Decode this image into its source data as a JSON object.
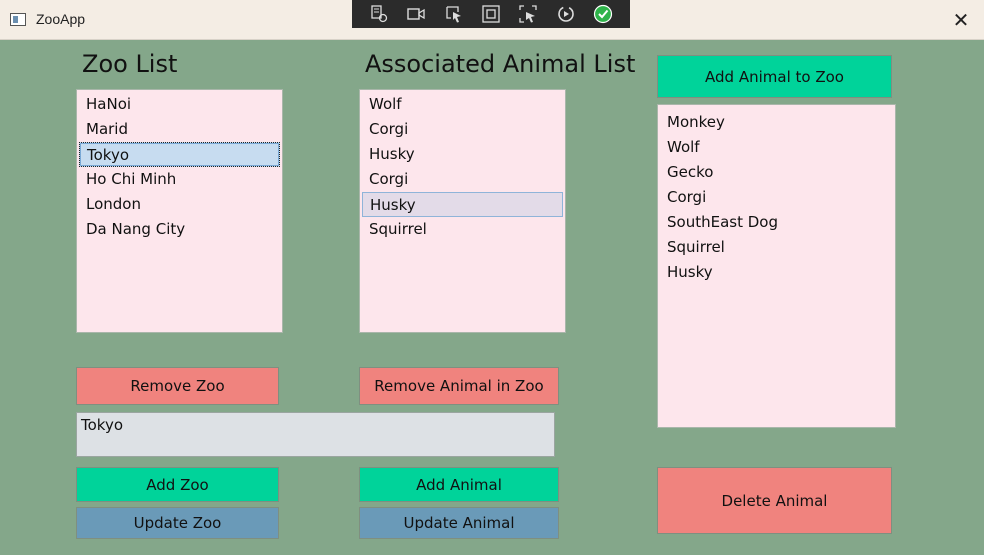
{
  "window": {
    "title": "ZooApp",
    "close_glyph": "✕"
  },
  "debug_toolbar": {
    "icons": [
      "live-visual-tree-icon",
      "record-icon",
      "select-element-icon",
      "display-layout-adorners-icon",
      "track-focus-icon",
      "hot-reload-icon",
      "binding-check-icon"
    ]
  },
  "zoo_list": {
    "heading": "Zoo List",
    "items": [
      "HaNoi",
      "Marid",
      "Tokyo",
      "Ho Chi Minh",
      "London",
      "Da Nang City"
    ],
    "selected": "Tokyo"
  },
  "associated_animals": {
    "heading": "Associated Animal List",
    "items": [
      "Wolf",
      "Corgi",
      "Husky",
      "Corgi",
      "Husky",
      "Squirrel"
    ],
    "selected_index": 4
  },
  "all_animals": {
    "items": [
      "Monkey",
      "Wolf",
      "Gecko",
      "Corgi",
      "SouthEast Dog",
      "Squirrel",
      "Husky"
    ]
  },
  "buttons": {
    "add_animal_to_zoo": "Add Animal to Zoo",
    "remove_zoo": "Remove Zoo",
    "remove_animal_in_zoo": "Remove Animal in Zoo",
    "add_zoo": "Add Zoo",
    "add_animal": "Add Animal",
    "update_zoo": "Update Zoo",
    "update_animal": "Update Animal",
    "delete_animal": "Delete Animal"
  },
  "input": {
    "value": "Tokyo"
  },
  "colors": {
    "background": "#84a78a",
    "list_background": "#fde6ec",
    "red_button": "#f0837e",
    "green_button": "#00d39a",
    "blue_button": "#6a9ab8"
  }
}
